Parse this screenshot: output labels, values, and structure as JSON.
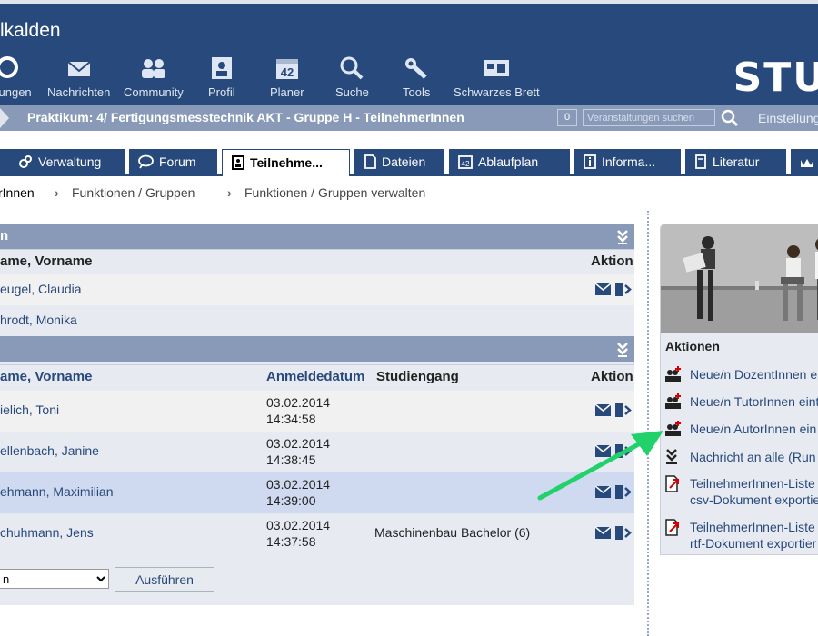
{
  "header": {
    "site_title": "lkalden",
    "logo": "STU",
    "nav": [
      {
        "label": "ltungen",
        "icon": "courses-icon"
      },
      {
        "label": "Nachrichten",
        "icon": "mail-icon"
      },
      {
        "label": "Community",
        "icon": "community-icon"
      },
      {
        "label": "Profil",
        "icon": "profile-icon"
      },
      {
        "label": "Planer",
        "icon": "calendar-icon"
      },
      {
        "label": "Suche",
        "icon": "search-icon"
      },
      {
        "label": "Tools",
        "icon": "wrench-icon"
      },
      {
        "label": "Schwarzes Brett",
        "icon": "board-icon"
      }
    ]
  },
  "context": {
    "title": "Praktikum: 4/ Fertigungsmesstechnik AKT - Gruppe H - TeilnehmerInnen",
    "count": "0",
    "search_placeholder": "Veranstaltungen suchen",
    "settings": "Einstellung"
  },
  "tabs": [
    {
      "label": "Verwaltung",
      "icon": "admin-icon"
    },
    {
      "label": "Forum",
      "icon": "forum-icon"
    },
    {
      "label": "Teilnehme...",
      "icon": "members-icon"
    },
    {
      "label": "Dateien",
      "icon": "files-icon"
    },
    {
      "label": "Ablaufplan",
      "icon": "schedule-icon"
    },
    {
      "label": "Informa...",
      "icon": "info-icon"
    },
    {
      "label": "Literatur",
      "icon": "literature-icon"
    }
  ],
  "breadcrumb": [
    "rInnen",
    "Funktionen / Gruppen",
    "Funktionen / Gruppen verwalten"
  ],
  "section1": {
    "title": "n",
    "col_name": "ame, Vorname",
    "col_action": "Aktion",
    "rows": [
      {
        "name": "eugel, Claudia"
      },
      {
        "name": "hrodt, Monika"
      }
    ]
  },
  "section2": {
    "col_name": "ame, Vorname",
    "col_date": "Anmeldedatum",
    "col_course": "Studiengang",
    "col_action": "Aktion",
    "rows": [
      {
        "name": "ielich, Toni",
        "date": "03.02.2014",
        "time": "14:34:58",
        "course": ""
      },
      {
        "name": "ellenbach, Janine",
        "date": "03.02.2014",
        "time": "14:38:45",
        "course": ""
      },
      {
        "name": "ehmann, Maximilian",
        "date": "03.02.2014",
        "time": "14:39:00",
        "course": ""
      },
      {
        "name": "chuhmann, Jens",
        "date": "03.02.2014",
        "time": "14:37:58",
        "course": "Maschinenbau Bachelor (6)"
      }
    ]
  },
  "bulk": {
    "select_value": "n",
    "execute_label": "Ausführen"
  },
  "sidebar": {
    "title": "Aktionen",
    "items": [
      {
        "label": "Neue/n DozentInnen e",
        "icon": "add-user-icon"
      },
      {
        "label": "Neue/n TutorInnen eint",
        "icon": "add-user-icon"
      },
      {
        "label": "Neue/n AutorInnen ein",
        "icon": "add-user-icon"
      },
      {
        "label": "Nachricht an alle (Run",
        "icon": "mail-all-icon"
      },
      {
        "label": "TeilnehmerInnen-Liste",
        "label2": "csv-Dokument exportie",
        "icon": "export-icon"
      },
      {
        "label": "TeilnehmerInnen-Liste",
        "label2": "rtf-Dokument exportier",
        "icon": "export-icon"
      }
    ]
  },
  "colors": {
    "brand": "#28497c",
    "bar": "#899ab9",
    "panel": "#e7ebf1",
    "highlight_arrow": "#21d26b"
  }
}
